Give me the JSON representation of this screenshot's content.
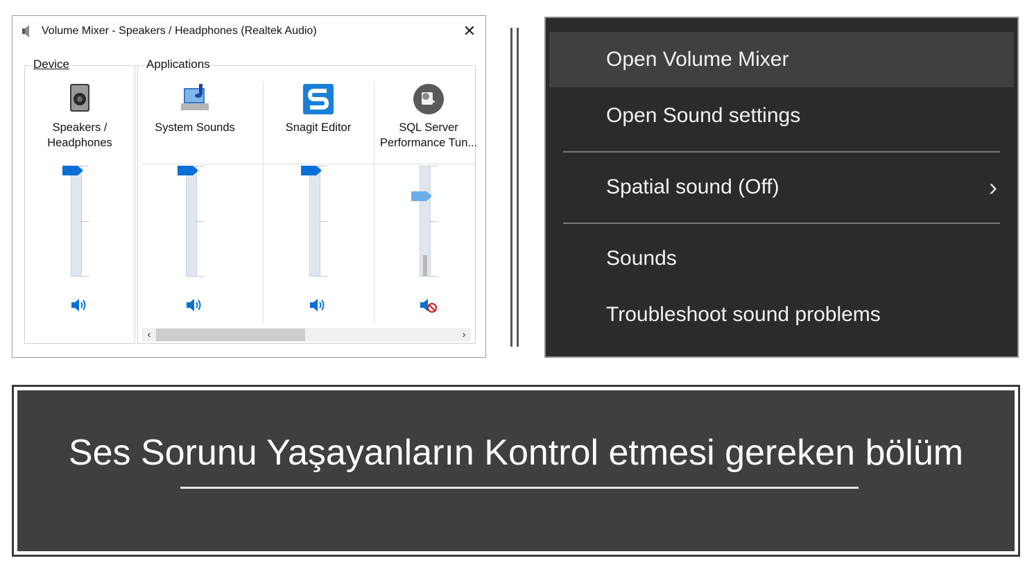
{
  "mixer": {
    "title": "Volume Mixer - Speakers / Headphones (Realtek Audio)",
    "close_glyph": "✕",
    "device_group_label": "Device",
    "apps_group_label": "Applications",
    "device": {
      "name_line1": "Speakers /",
      "name_line2": "Headphones",
      "icon": "speaker-box-icon",
      "volume_fraction": 1.0,
      "muted": false
    },
    "applications": [
      {
        "name_line1": "System Sounds",
        "name_line2": "",
        "icon": "system-sounds-icon",
        "volume_fraction": 1.0,
        "muted": false
      },
      {
        "name_line1": "Snagit Editor",
        "name_line2": "",
        "icon": "snagit-icon",
        "volume_fraction": 1.0,
        "muted": false
      },
      {
        "name_line1": "SQL Server",
        "name_line2": "Performance Tun...",
        "icon": "sql-server-icon",
        "volume_fraction": 0.75,
        "muted": true
      }
    ],
    "scroll_left_glyph": "‹",
    "scroll_right_glyph": "›"
  },
  "menu": {
    "items": [
      {
        "label": "Open Volume Mixer",
        "highlighted": true
      },
      {
        "label": "Open Sound settings",
        "highlighted": false
      },
      {
        "label": "Spatial sound (Off)",
        "highlighted": false,
        "has_submenu": true
      },
      {
        "label": "Sounds",
        "highlighted": false
      },
      {
        "label": "Troubleshoot sound problems",
        "highlighted": false
      }
    ],
    "submenu_glyph": "›"
  },
  "banner": {
    "text": "Ses Sorunu Yaşayanların Kontrol etmesi gereken bölüm"
  },
  "colors": {
    "slider_thumb": "#0a6fd6",
    "slider_thumb_muted": "#6aaee8",
    "menu_bg": "#2b2b2b",
    "menu_highlight": "#404040",
    "banner_bg": "#3f3f3f"
  }
}
